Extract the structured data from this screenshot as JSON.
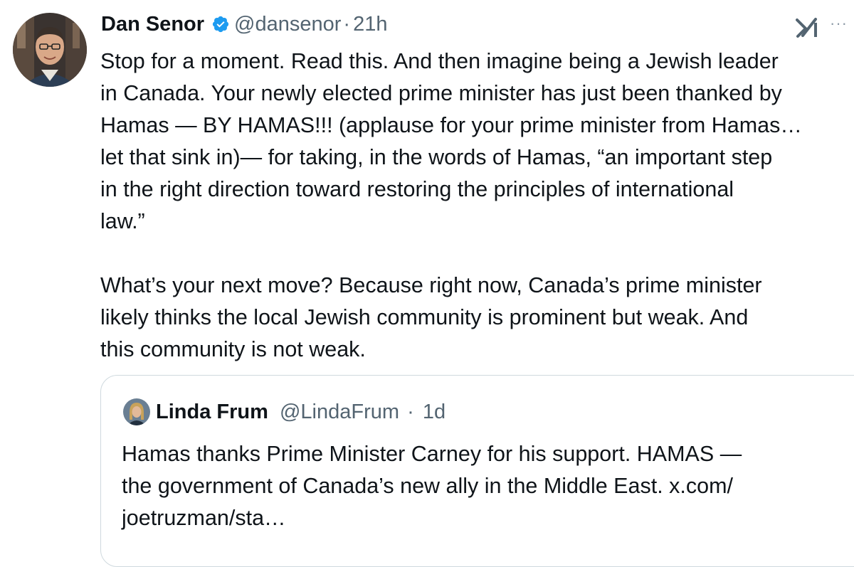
{
  "tweet": {
    "author_name": "Dan Senor",
    "author_handle": "@dansenor",
    "separator": "·",
    "time": "21h",
    "more_icon": "···",
    "paragraph1": [
      "Stop for a moment. Read this. And then imagine being a Jewish leader",
      "in Canada. Your newly elected prime minister has just been thanked by",
      "Hamas — BY HAMAS!!! (applause for your prime minister from Hamas…",
      "let that sink in)— for taking, in the words of Hamas, “an important step",
      "in the right direction toward restoring the principles of international",
      "law.”"
    ],
    "paragraph2": [
      "What’s your next move? Because right now, Canada’s prime minister",
      "likely thinks the local Jewish community is prominent but weak. And",
      "this community is not weak."
    ]
  },
  "quoted": {
    "author_name": "Linda Frum",
    "author_handle": "@LindaFrum",
    "separator": "·",
    "time": "1d",
    "lines": [
      "Hamas thanks Prime Minister Carney for his support.  HAMAS —",
      "the government of Canada’s new ally in the Middle East. x.com/",
      "joetruzman/sta…"
    ]
  },
  "colors": {
    "text": "#0f1419",
    "secondary": "#536471",
    "verified": "#1d9bf0",
    "border": "#cfd9de"
  },
  "icons": {
    "verified": "verified-badge-icon",
    "grok": "grok-icon",
    "more": "more-icon"
  }
}
